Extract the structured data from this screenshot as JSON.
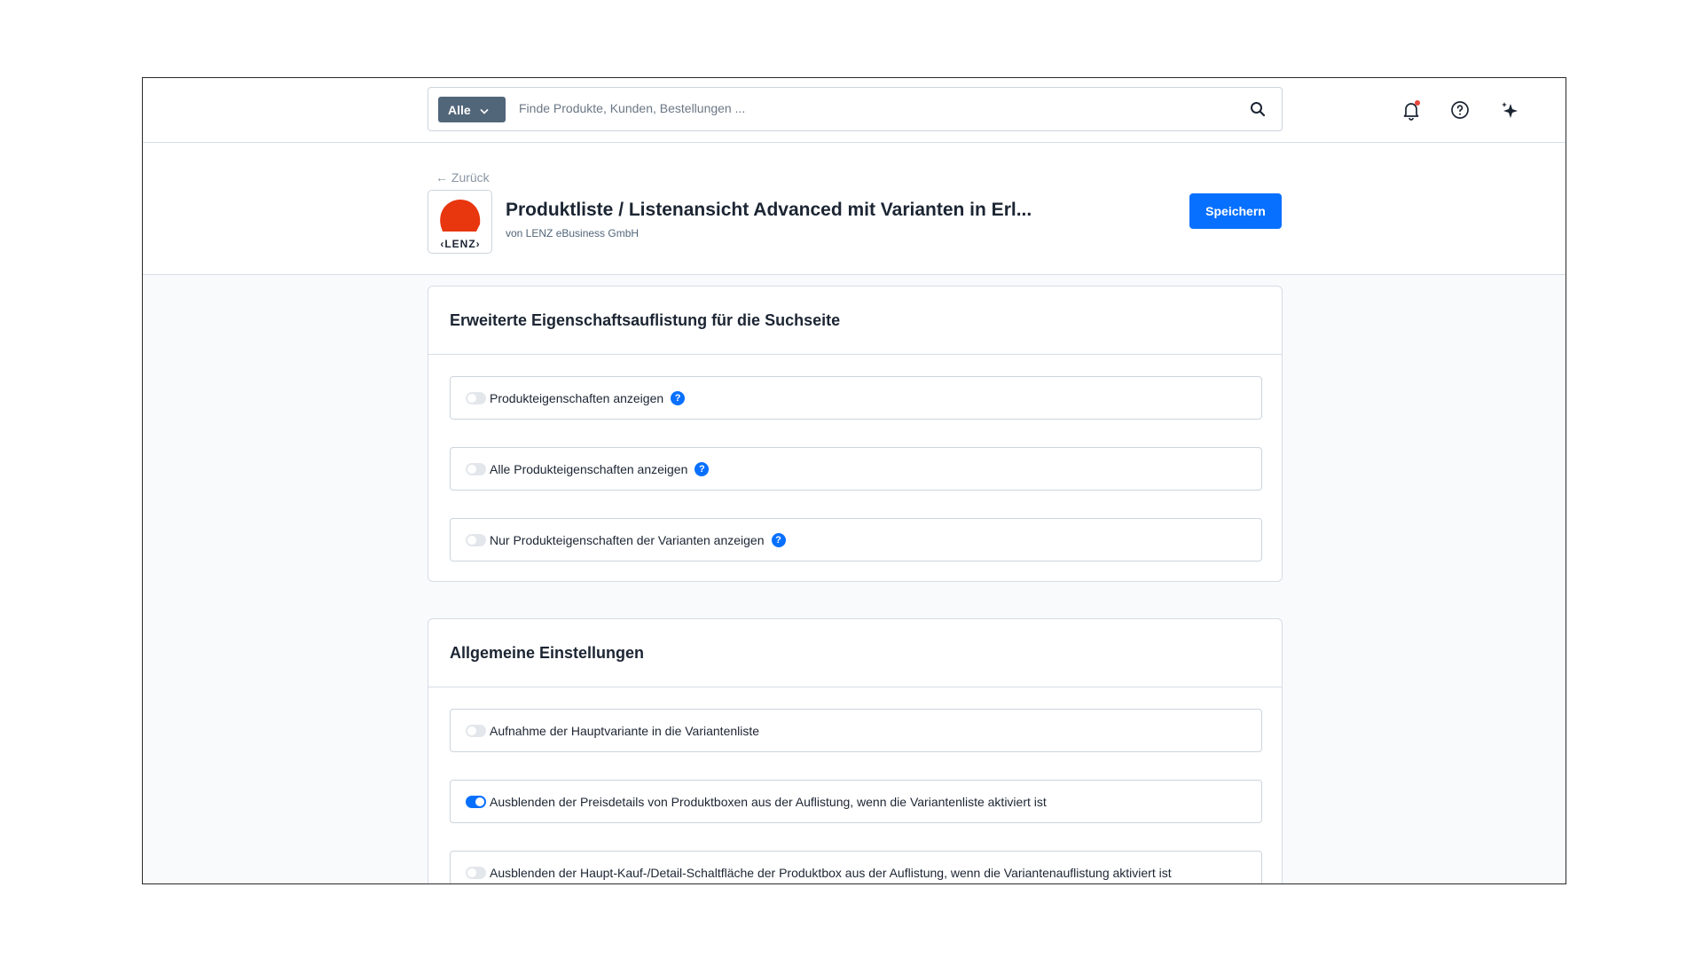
{
  "search": {
    "scope_label": "Alle",
    "placeholder": "Finde Produkte, Kunden, Bestellungen ..."
  },
  "header": {
    "back_label": "← Zurück",
    "title": "Produktliste / Listenansicht Advanced mit Varianten in Erl...",
    "subtitle": "von LENZ eBusiness GmbH",
    "save_label": "Speichern",
    "logo_text": "‹LENZ›"
  },
  "colors": {
    "accent": "#0870ff",
    "notification_dot": "#e8453c",
    "logo_red": "#e8360f"
  },
  "sections": [
    {
      "title": "Erweiterte Eigenschaftsauflistung für die Suchseite",
      "options": [
        {
          "label": "Produkteigenschaften anzeigen",
          "enabled": false,
          "help": "?"
        },
        {
          "label": "Alle Produkteigenschaften anzeigen",
          "enabled": false,
          "help": "?"
        },
        {
          "label": "Nur Produkteigenschaften der Varianten anzeigen",
          "enabled": false,
          "help": "?"
        }
      ]
    },
    {
      "title": "Allgemeine Einstellungen",
      "options": [
        {
          "label": "Aufnahme der Hauptvariante in die Variantenliste",
          "enabled": false
        },
        {
          "label": "Ausblenden der Preisdetails von Produktboxen aus der Auflistung, wenn die Variantenliste aktiviert ist",
          "enabled": true
        },
        {
          "label": "Ausblenden der Haupt-Kauf-/Detail-Schaltfläche der Produktbox aus der Auflistung, wenn die Variantenauflistung aktiviert ist",
          "enabled": false
        }
      ]
    }
  ]
}
